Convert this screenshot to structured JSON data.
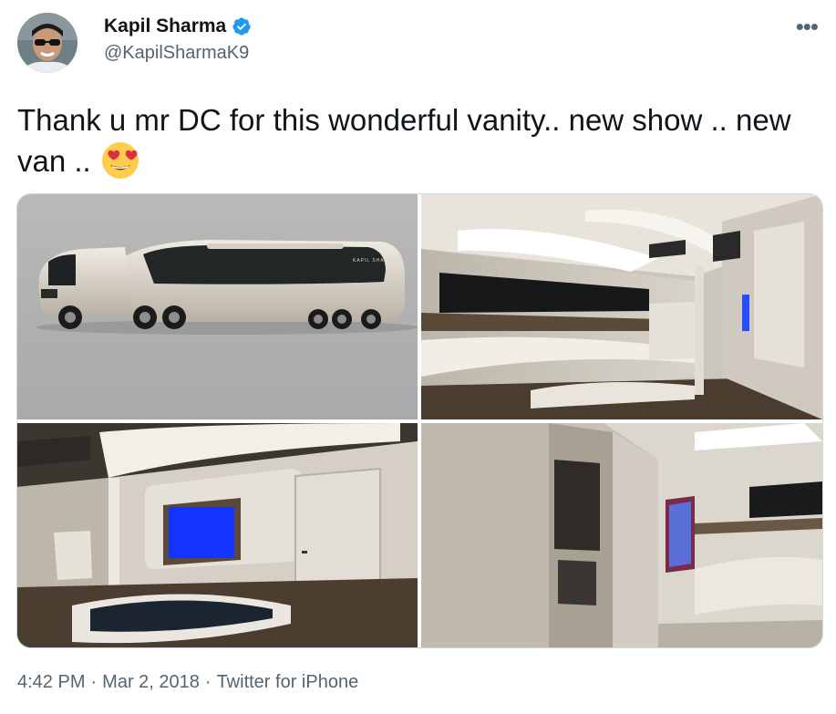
{
  "author": {
    "name": "Kapil Sharma",
    "handle": "@KapilSharmaK9",
    "verified": true
  },
  "tweet": {
    "text": "Thank u mr DC for this wonderful vanity.. new show .. new van ..",
    "emoji": "smiling-face-with-heart-eyes",
    "media_count": 4
  },
  "media": {
    "truck_logo_text": "KAPIL SHARMA"
  },
  "footer": {
    "time": "4:42 PM",
    "separator": "·",
    "date": "Mar 2, 2018",
    "source": "Twitter for iPhone"
  },
  "more_icon": "more-horizontal-icon",
  "colors": {
    "verified": "#1d9bf0",
    "secondary_text": "#536471",
    "screen_blue": "#1434ff"
  }
}
